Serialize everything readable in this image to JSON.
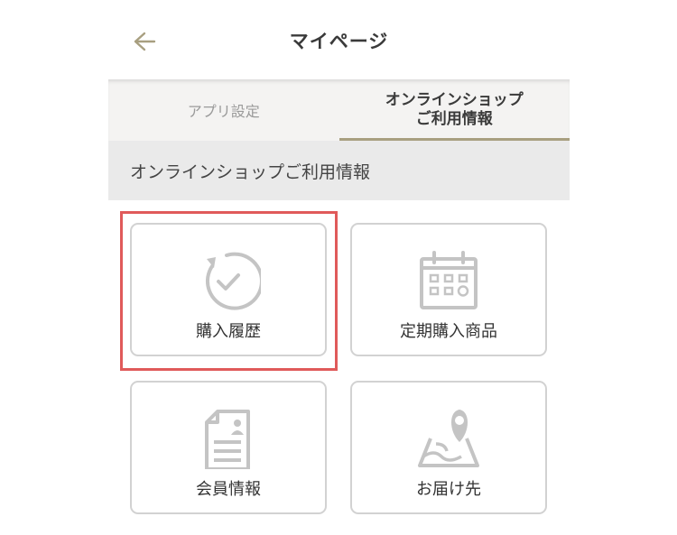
{
  "header": {
    "title": "マイページ",
    "back_icon": "arrow-left-icon"
  },
  "tabs": [
    {
      "label_lines": [
        "アプリ設定"
      ],
      "active": false
    },
    {
      "label_lines": [
        "オンラインショップ",
        "ご利用情報"
      ],
      "active": true
    }
  ],
  "section": {
    "title": "オンラインショップご利用情報"
  },
  "menu": [
    {
      "label": "購入履歴",
      "icon": "refresh-check-icon",
      "highlighted": true
    },
    {
      "label": "定期購入商品",
      "icon": "calendar-icon",
      "highlighted": false
    },
    {
      "label": "会員情報",
      "icon": "member-document-icon",
      "highlighted": false
    },
    {
      "label": "お届け先",
      "icon": "map-pin-icon",
      "highlighted": false
    }
  ],
  "colors": {
    "accent": "#a89f80",
    "highlight": "#e05a5a",
    "icon_gray": "#c4c4c4",
    "section_bg": "#eaeaea",
    "tabs_bg": "#f4f3f2"
  }
}
